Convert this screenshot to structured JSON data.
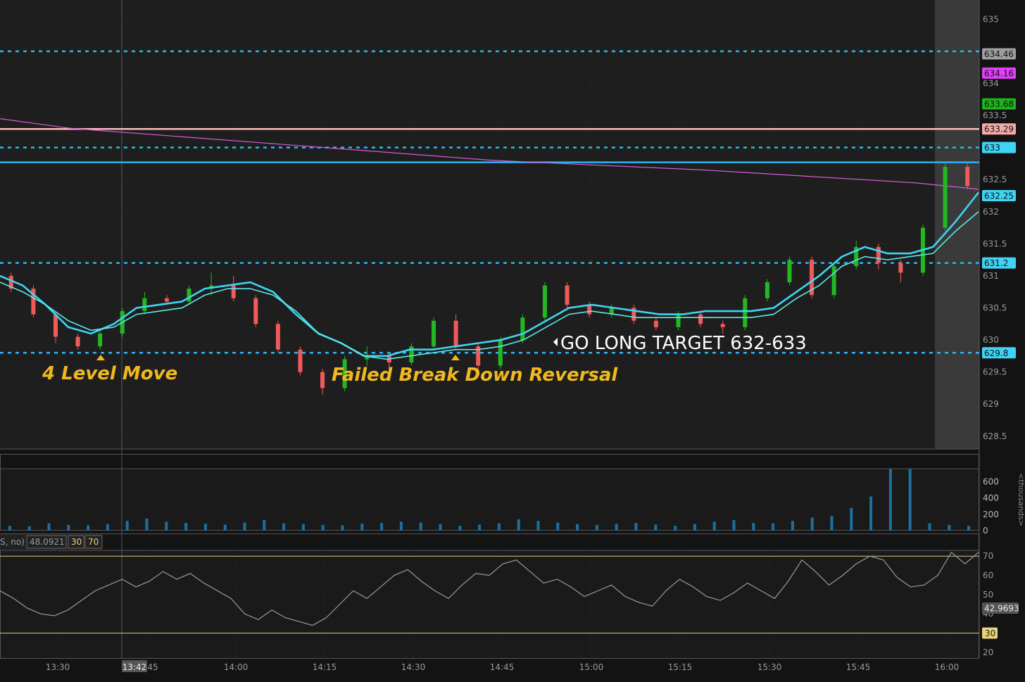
{
  "chart_data": {
    "type": "line",
    "time_labels": [
      "13:30",
      "13:42",
      "45",
      "14:00",
      "14:15",
      "14:30",
      "14:45",
      "15:00",
      "15:15",
      "15:30",
      "15:45",
      "16:00"
    ],
    "price_panel": {
      "ylim": [
        628.3,
        635.3
      ],
      "y_ticks": [
        "635",
        "634",
        "633.5",
        "632.5",
        "632",
        "631.5",
        "631",
        "630.5",
        "630",
        "629.5",
        "629",
        "628.5"
      ],
      "y_tick_values": [
        635,
        634,
        633.5,
        632.5,
        632,
        631.5,
        631,
        630.5,
        630,
        629.5,
        629,
        628.5
      ],
      "price_badges": [
        {
          "label": "634.46",
          "value": 634.46,
          "color": "#9e9e9e"
        },
        {
          "label": "634.16",
          "value": 634.16,
          "color": "#e040fb"
        },
        {
          "label": "633.68",
          "value": 633.68,
          "color": "#1db51d"
        },
        {
          "label": "633.29",
          "value": 633.29,
          "color": "#f4a9a9"
        },
        {
          "label": "633",
          "value": 633.0,
          "color": "#3fd4f4"
        },
        {
          "label": "632.25",
          "value": 632.25,
          "color": "#3fd4f4"
        },
        {
          "label": "631.2",
          "value": 631.2,
          "color": "#3fd4f4"
        },
        {
          "label": "629.8",
          "value": 629.8,
          "color": "#3fd4f4"
        }
      ],
      "levels": [
        {
          "value": 634.5,
          "style": "dashed",
          "color": "#29b6f6"
        },
        {
          "value": 633.29,
          "style": "solid",
          "color": "#f8bbbb"
        },
        {
          "value": 633.0,
          "style": "dashed",
          "color": "#29b6f6"
        },
        {
          "value": 632.77,
          "style": "solid",
          "color": "#29b6f6"
        },
        {
          "value": 631.2,
          "style": "dashed",
          "color": "#29b6f6"
        },
        {
          "value": 629.8,
          "style": "dashed",
          "color": "#29b6f6"
        }
      ],
      "vwap_line": {
        "color": "#d65cd6",
        "points": [
          [
            0,
            633.45
          ],
          [
            100,
            633.3
          ],
          [
            400,
            633.05
          ],
          [
            700,
            632.8
          ],
          [
            1000,
            632.65
          ],
          [
            1300,
            632.45
          ],
          [
            1390,
            632.35
          ]
        ]
      },
      "series": [
        {
          "color": "#3fd4f4",
          "values": [
            631.0,
            630.85,
            630.55,
            630.2,
            630.1,
            630.25,
            630.5,
            630.55,
            630.6,
            630.8,
            630.85,
            630.9,
            630.75,
            630.4,
            630.1,
            629.95,
            629.75,
            629.75,
            629.85,
            629.85,
            629.9,
            629.95,
            630.0,
            630.1,
            630.3,
            630.5,
            630.55,
            630.5,
            630.45,
            630.4,
            630.4,
            630.45,
            630.45,
            630.45,
            630.5,
            630.75,
            631.0,
            631.3,
            631.45,
            631.35,
            631.35,
            631.45,
            631.85,
            632.3
          ]
        },
        {
          "color": "#5ee8e8",
          "values": [
            630.9,
            630.75,
            630.55,
            630.3,
            630.15,
            630.2,
            630.4,
            630.45,
            630.5,
            630.7,
            630.8,
            630.8,
            630.7,
            630.45,
            630.1,
            629.95,
            629.75,
            629.7,
            629.75,
            629.8,
            629.85,
            629.85,
            629.9,
            630.0,
            630.2,
            630.4,
            630.45,
            630.4,
            630.35,
            630.35,
            630.35,
            630.35,
            630.35,
            630.35,
            630.4,
            630.65,
            630.85,
            631.15,
            631.3,
            631.25,
            631.3,
            631.35,
            631.7,
            632.0
          ]
        }
      ],
      "candles": [
        [
          631.0,
          631.05,
          630.75,
          630.8
        ],
        [
          630.8,
          630.85,
          630.35,
          630.4
        ],
        [
          630.4,
          630.45,
          629.95,
          630.05
        ],
        [
          630.05,
          630.1,
          629.85,
          629.9
        ],
        [
          629.9,
          630.15,
          629.85,
          630.1
        ],
        [
          630.1,
          630.5,
          630.05,
          630.45
        ],
        [
          630.45,
          630.75,
          630.4,
          630.65
        ],
        [
          630.65,
          630.7,
          630.55,
          630.6
        ],
        [
          630.6,
          630.85,
          630.55,
          630.8
        ],
        [
          630.8,
          631.05,
          630.7,
          630.85
        ],
        [
          630.85,
          631.0,
          630.6,
          630.65
        ],
        [
          630.65,
          630.7,
          630.2,
          630.25
        ],
        [
          630.25,
          630.3,
          629.8,
          629.85
        ],
        [
          629.85,
          629.9,
          629.45,
          629.5
        ],
        [
          629.5,
          629.55,
          629.15,
          629.25
        ],
        [
          629.25,
          629.75,
          629.2,
          629.7
        ],
        [
          629.7,
          629.9,
          629.6,
          629.75
        ],
        [
          629.75,
          629.8,
          629.55,
          629.65
        ],
        [
          629.65,
          629.95,
          629.6,
          629.9
        ],
        [
          629.9,
          630.35,
          629.85,
          630.3
        ],
        [
          630.3,
          630.4,
          629.85,
          629.9
        ],
        [
          629.9,
          629.95,
          629.55,
          629.6
        ],
        [
          629.6,
          630.05,
          629.55,
          630.0
        ],
        [
          630.0,
          630.4,
          629.95,
          630.35
        ],
        [
          630.35,
          630.9,
          630.3,
          630.85
        ],
        [
          630.85,
          630.9,
          630.5,
          630.55
        ],
        [
          630.55,
          630.6,
          630.35,
          630.4
        ],
        [
          630.4,
          630.55,
          630.35,
          630.5
        ],
        [
          630.5,
          630.55,
          630.25,
          630.3
        ],
        [
          630.3,
          630.35,
          630.15,
          630.2
        ],
        [
          630.2,
          630.45,
          630.15,
          630.4
        ],
        [
          630.4,
          630.45,
          630.2,
          630.25
        ],
        [
          630.25,
          630.3,
          630.1,
          630.2
        ],
        [
          630.2,
          630.7,
          630.15,
          630.65
        ],
        [
          630.65,
          630.95,
          630.6,
          630.9
        ],
        [
          630.9,
          631.3,
          630.85,
          631.25
        ],
        [
          631.25,
          631.3,
          630.65,
          630.7
        ],
        [
          630.7,
          631.2,
          630.65,
          631.15
        ],
        [
          631.15,
          631.55,
          631.1,
          631.45
        ],
        [
          631.45,
          631.5,
          631.1,
          631.2
        ],
        [
          631.2,
          631.25,
          630.9,
          631.05
        ],
        [
          631.05,
          631.8,
          631.0,
          631.75
        ],
        [
          631.75,
          632.75,
          631.7,
          632.7
        ],
        [
          632.7,
          632.75,
          632.35,
          632.4
        ]
      ]
    },
    "text_annotations": [
      {
        "text": "4 Level Move",
        "color": "#f0b820"
      },
      {
        "text": "Failed Break Down Reversal",
        "color": "#f0b820"
      },
      {
        "text": "GO LONG TARGET 632-633",
        "color": "#ffffff"
      }
    ],
    "volume_panel": {
      "y_ticks": [
        "600",
        "400",
        "200",
        "0"
      ],
      "y_tick_values": [
        600,
        400,
        200,
        0
      ],
      "unit_label": "<thousands>",
      "ylim": [
        0,
        760
      ],
      "color": "#1d6fa0",
      "values": [
        60,
        55,
        90,
        70,
        65,
        80,
        120,
        150,
        110,
        95,
        85,
        75,
        100,
        130,
        90,
        80,
        70,
        65,
        85,
        95,
        110,
        100,
        80,
        60,
        75,
        90,
        140,
        120,
        100,
        80,
        70,
        85,
        95,
        75,
        60,
        80,
        110,
        130,
        95,
        90,
        120,
        160,
        180,
        280,
        420,
        760,
        760,
        90,
        70,
        60
      ]
    },
    "rsi_panel": {
      "header": {
        "label": "S, no)",
        "value": "48.0921",
        "low": "30",
        "high": "70"
      },
      "y_ticks": [
        "70",
        "60",
        "50",
        "40",
        "30",
        "20"
      ],
      "y_tick_values": [
        70,
        60,
        50,
        40,
        30,
        20
      ],
      "ylim": [
        17,
        73
      ],
      "levels": [
        70,
        30
      ],
      "current_badge": "42.9693",
      "low_badge": "30",
      "values": [
        52,
        48,
        43,
        40,
        39,
        42,
        47,
        52,
        55,
        58,
        54,
        57,
        62,
        58,
        61,
        56,
        52,
        48,
        40,
        37,
        42,
        38,
        36,
        34,
        38,
        45,
        52,
        48,
        54,
        60,
        63,
        57,
        52,
        48,
        55,
        61,
        60,
        66,
        68,
        62,
        56,
        58,
        54,
        49,
        52,
        55,
        49,
        46,
        44,
        52,
        58,
        54,
        49,
        47,
        51,
        56,
        52,
        48,
        57,
        68,
        62,
        55,
        60,
        66,
        70,
        68,
        59,
        54,
        55,
        60,
        72,
        66,
        72
      ]
    }
  }
}
